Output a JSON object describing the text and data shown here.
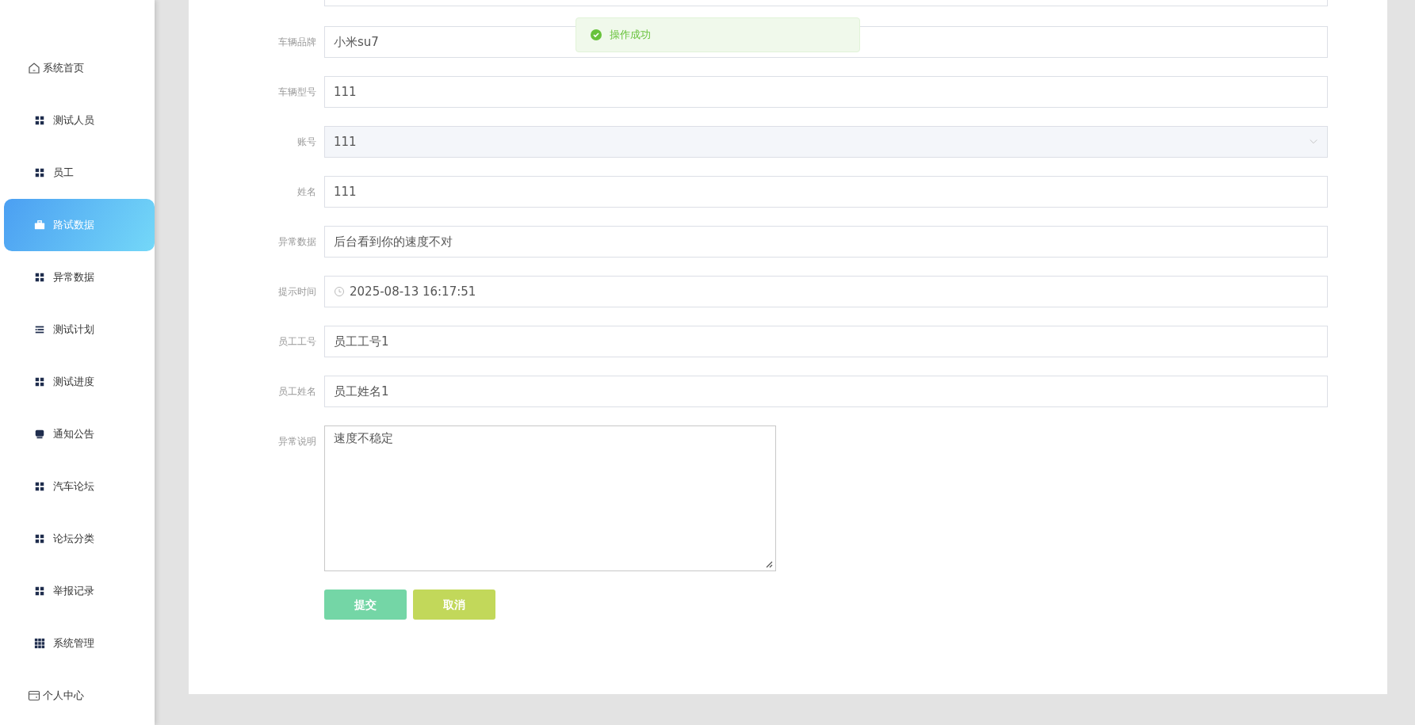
{
  "sidebar": {
    "items": [
      {
        "label": "系统首页",
        "kind": "plain",
        "selected": false
      },
      {
        "label": "测试人员",
        "kind": "menu",
        "selected": false
      },
      {
        "label": "员工",
        "kind": "menu",
        "selected": false
      },
      {
        "label": "路试数据",
        "kind": "menu",
        "selected": true
      },
      {
        "label": "异常数据",
        "kind": "menu",
        "selected": false
      },
      {
        "label": "测试计划",
        "kind": "menu",
        "selected": false
      },
      {
        "label": "测试进度",
        "kind": "menu",
        "selected": false
      },
      {
        "label": "通知公告",
        "kind": "menu",
        "selected": false
      },
      {
        "label": "汽车论坛",
        "kind": "menu",
        "selected": false
      },
      {
        "label": "论坛分类",
        "kind": "menu",
        "selected": false
      },
      {
        "label": "举报记录",
        "kind": "menu",
        "selected": false
      },
      {
        "label": "系统管理",
        "kind": "menu",
        "selected": false
      },
      {
        "label": "个人中心",
        "kind": "plain",
        "selected": false
      }
    ]
  },
  "form": {
    "fields": [
      {
        "label": "车辆品牌",
        "kind": "text",
        "value": "小米su7"
      },
      {
        "label": "车辆型号",
        "kind": "text",
        "value": "111"
      },
      {
        "label": "账号",
        "kind": "select",
        "value": "111"
      },
      {
        "label": "姓名",
        "kind": "text",
        "value": "111"
      },
      {
        "label": "异常数据",
        "kind": "text",
        "value": "后台看到你的速度不对"
      },
      {
        "label": "提示时间",
        "kind": "datetime",
        "value": "2025-08-13 16:17:51"
      },
      {
        "label": "员工工号",
        "kind": "text",
        "value": "员工工号1"
      },
      {
        "label": "员工姓名",
        "kind": "text",
        "value": "员工姓名1"
      },
      {
        "label": "异常说明",
        "kind": "textarea",
        "value": "速度不稳定"
      }
    ],
    "buttons": [
      {
        "label": "提交",
        "kind": "submit"
      },
      {
        "label": "取消",
        "kind": "cancel"
      }
    ]
  },
  "toast": {
    "message": "操作成功"
  }
}
